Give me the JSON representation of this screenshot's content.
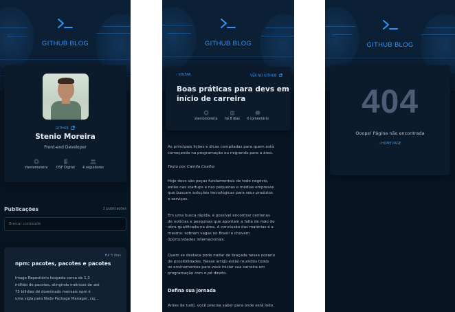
{
  "brand": "GITHUB BLOG",
  "colors": {
    "background": "#071422",
    "card": "#0b1b2b",
    "accent": "#3294f8",
    "title": "#e7edf4",
    "text": "#afc2d4"
  },
  "profile": {
    "github_link": "GITHUB",
    "name": "Stenio Moreira",
    "role": "Front-end Developer",
    "username": "steniomoreira",
    "company": "OSF Digital",
    "followers": "4 seguidores",
    "icons": [
      "github-icon",
      "building-icon",
      "users-icon",
      "external-link-icon"
    ]
  },
  "publications": {
    "title": "Publicações",
    "count": "2 publicações",
    "search_placeholder": "Buscar conteúdo",
    "items": [
      {
        "date": "Há 5 dias",
        "title": "npm: pacotes, pacotes e pacotes",
        "excerpt_lines": [
          "Image Repositório hospeda cerca de 1,3",
          "milhão de pacotes, atingindo métricas de até",
          "75 bilhões de downloads mensais npm é",
          "uma sigla para Node Package Manager, cuj..."
        ]
      }
    ]
  },
  "post": {
    "back_label": "VOLTAR",
    "github_label": "VER NO GITHUB",
    "title_lines": [
      "Boas práticas para devs em",
      "início de carreira"
    ],
    "username": "steniomoreira",
    "date": "há 8 dias",
    "comments": "0 comentário",
    "icons": [
      "chevron-left-icon",
      "external-link-icon",
      "github-icon",
      "calendar-icon",
      "comment-icon"
    ],
    "body": {
      "intro": [
        "As principais lições e dicas compiladas para quem está",
        "começando na programação ou migrando para a área."
      ],
      "author": "Texto por Camila Coelho",
      "p1": [
        "Hoje devs são peças fundamentais de todo negócio,",
        "estão nas startups e nas pequenas e médias empresas",
        "que buscam soluções tecnológicas para seus produtos",
        "e serviços."
      ],
      "p2": [
        "Em uma busca rápida, é possível encontrar centenas",
        "de notícias e pesquisas que apontam a falta de mão de",
        "obra qualificada na área. A conclusão das matérias é a",
        "mesma: sobram vagas no Brasil e chovem",
        "oportunidades internacionais."
      ],
      "p3": [
        "Quem se destaca pode nadar de braçada nesse oceano",
        "de possibilidades. Nesse artigo estão reunidos todos",
        "os ensinamentos para você iniciar sua carreira em",
        "programação com o pé direito."
      ],
      "heading": "Defina sua jornada",
      "p4": [
        "Antes de tudo, você precisa saber para onde está indo."
      ]
    }
  },
  "not_found": {
    "code": "404",
    "message": "Ooops! Página não encontrada",
    "home_label": "HOME PAGE",
    "icons": [
      "chevron-left-icon"
    ]
  }
}
